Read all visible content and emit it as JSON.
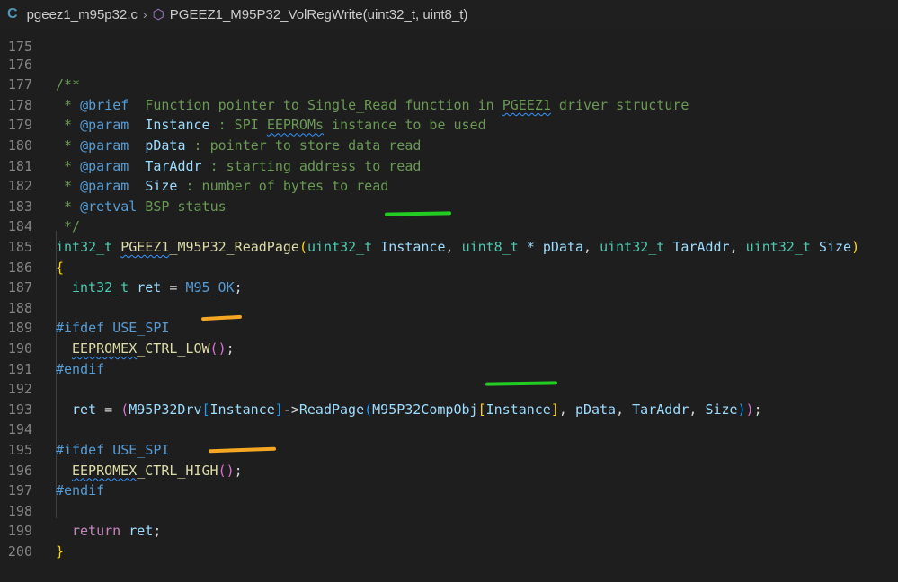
{
  "breadcrumb": {
    "lang_icon": "C",
    "file": "pgeez1_m95p32.c",
    "separator": "›",
    "symbol_icon": "cube-icon",
    "symbol": "PGEEZ1_M95P32_VolRegWrite(uint32_t, uint8_t)"
  },
  "lines": [
    {
      "n": "175"
    },
    {
      "n": "176"
    },
    {
      "n": "177"
    },
    {
      "n": "178"
    },
    {
      "n": "179"
    },
    {
      "n": "180"
    },
    {
      "n": "181"
    },
    {
      "n": "182"
    },
    {
      "n": "183"
    },
    {
      "n": "184"
    },
    {
      "n": "185"
    },
    {
      "n": "186"
    },
    {
      "n": "187"
    },
    {
      "n": "188"
    },
    {
      "n": "189"
    },
    {
      "n": "190"
    },
    {
      "n": "191"
    },
    {
      "n": "192"
    },
    {
      "n": "193"
    },
    {
      "n": "194"
    },
    {
      "n": "195"
    },
    {
      "n": "196"
    },
    {
      "n": "197"
    },
    {
      "n": "198"
    },
    {
      "n": "199"
    },
    {
      "n": "200"
    }
  ],
  "code": {
    "l176": "/**",
    "l177": {
      "star": " * ",
      "tag": "@brief",
      "text1": "  Function pointer to Single_Read function in ",
      "sq": "PGEEZ1",
      "text2": " driver structure"
    },
    "l178": {
      "star": " * ",
      "tag": "@param",
      "param": "  Instance",
      "text1": " : SPI ",
      "sq": "EEPROMs",
      "text2": " instance to be used"
    },
    "l179": {
      "star": " * ",
      "tag": "@param",
      "param": "  pData",
      "text1": " : pointer to store data read"
    },
    "l180": {
      "star": " * ",
      "tag": "@param",
      "param": "  TarAddr",
      "text1": " : starting address to read"
    },
    "l181": {
      "star": " * ",
      "tag": "@param",
      "param": "  Size",
      "text1": " : number of bytes to read"
    },
    "l182": {
      "star": " * ",
      "tag": "@retval",
      "text1": " BSP status"
    },
    "l183": " */",
    "l184": {
      "t1": "int32_t",
      "sp1": " ",
      "fn_sq": "PGEEZ1",
      "fn_rest": "_M95P32_ReadPage",
      "op": "(",
      "t2": "uint32_t",
      "p1": " Instance",
      "c1": ", ",
      "t3": "uint8_t",
      "p2": " * pData",
      "c2": ", ",
      "t4": "uint32_t",
      "p3": " TarAddr",
      "c3": ", ",
      "t5": "uint32_t",
      "p4": " Size",
      "cl": ")"
    },
    "l185": "{",
    "l186": {
      "ty": "int32_t",
      "v": " ret",
      "eq": " = ",
      "mc": "M95_OK",
      "end": ";"
    },
    "l188": {
      "kw": "#ifdef",
      "mc": " USE_SPI"
    },
    "l189": {
      "fn_sq": "EEPROMEX",
      "fn_rest": "_CTRL_LOW",
      "op": "(",
      "cl": ")",
      "end": ";"
    },
    "l190": "#endif",
    "l192": {
      "v": "ret",
      "eq": " = ",
      "o1": "(",
      "v2": "M95P32Drv",
      "o2": "[",
      "v3": "Instance",
      "c2": "]",
      "arrow": "->",
      "v4": "ReadPage",
      "o3": "(",
      "v5": "M95P32CompObj",
      "o4": "[",
      "v6": "Instance",
      "c4": "]",
      "comma1": ", ",
      "v7": "pData",
      "comma2": ", ",
      "v8": "TarAddr",
      "comma3": ", ",
      "v9": "Size",
      "c3": ")",
      "c1": ")",
      "end": ";"
    },
    "l194": {
      "kw": "#ifdef",
      "mc": " USE_SPI"
    },
    "l195": {
      "fn_sq": "EEPROMEX",
      "fn_rest": "_CTRL_HIGH",
      "op": "(",
      "cl": ")",
      "end": ";"
    },
    "l196": "#endif",
    "l198": {
      "kw": "return",
      "v": " ret",
      "end": ";"
    },
    "l199": "}"
  },
  "annotation_colors": {
    "green": "#22cc22",
    "orange": "#f5a623"
  }
}
